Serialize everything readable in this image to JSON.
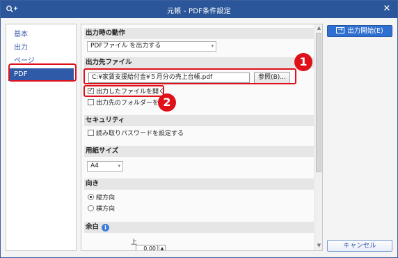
{
  "window": {
    "title": "元帳 - PDF条件設定",
    "close_glyph": "✕"
  },
  "sidebar": {
    "items": [
      {
        "label": "基本"
      },
      {
        "label": "出力"
      },
      {
        "label": "ページ"
      },
      {
        "label": "PDF"
      }
    ]
  },
  "sections": {
    "output_action": {
      "title": "出力時の動作",
      "select_value": "PDFファイル を出力する"
    },
    "output_file": {
      "title": "出力先ファイル",
      "path": "C:¥家賃支援給付金¥５月分の売上台帳.pdf",
      "browse_label": "参照(B)...",
      "open_file_label": "出力したファイルを開く",
      "open_folder_label": "出力先のフォルダーを開く"
    },
    "security": {
      "title": "セキュリティ",
      "password_label": "読み取りパスワードを設定する"
    },
    "paper_size": {
      "title": "用紙サイズ",
      "select_value": "A4"
    },
    "orientation": {
      "title": "向き",
      "portrait_label": "縦方向",
      "landscape_label": "横方向"
    },
    "margins": {
      "title": "余白",
      "top_label": "上",
      "top_value": "0.00"
    }
  },
  "buttons": {
    "start_output": "出力開始(E)",
    "cancel": "キャンセル"
  },
  "annotations": {
    "badge_1": "1",
    "badge_2": "2"
  },
  "colors": {
    "titlebar": "#2b579a",
    "accent": "#2f5aa8",
    "highlight": "#e0101a"
  }
}
